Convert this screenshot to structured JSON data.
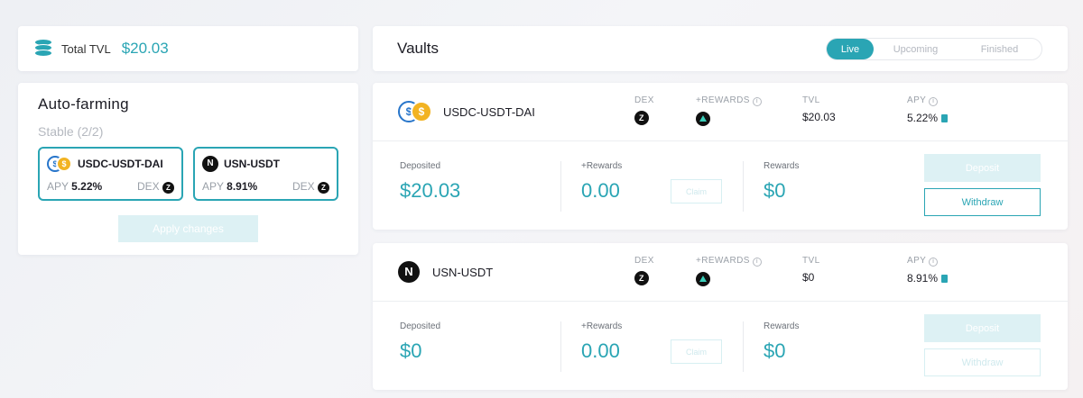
{
  "tvl": {
    "label": "Total TVL",
    "value": "$20.03"
  },
  "autofarming": {
    "title": "Auto-farming",
    "subtitle": "Stable (2/2)",
    "pools": [
      {
        "name": "USDC-USDT-DAI",
        "apy_label": "APY",
        "apy": "5.22%",
        "dex_label": "DEX"
      },
      {
        "name": "USN-USDT",
        "apy_label": "APY",
        "apy": "8.91%",
        "dex_label": "DEX"
      }
    ],
    "apply_label": "Apply changes"
  },
  "vaults": {
    "title": "Vaults",
    "tabs": [
      "Live",
      "Upcoming",
      "Finished"
    ],
    "headers": {
      "dex": "DEX",
      "rewards": "+REWARDS",
      "tvl": "TVL",
      "apy": "APY"
    },
    "labels": {
      "deposited": "Deposited",
      "plus_rewards": "+Rewards",
      "rewards": "Rewards",
      "claim": "Claim",
      "deposit": "Deposit",
      "withdraw": "Withdraw"
    },
    "items": [
      {
        "name": "USDC-USDT-DAI",
        "tvl": "$20.03",
        "apy": "5.22%",
        "deposited": "$20.03",
        "plus_rewards": "0.00",
        "rewards": "$0"
      },
      {
        "name": "USN-USDT",
        "tvl": "$0",
        "apy": "8.91%",
        "deposited": "$0",
        "plus_rewards": "0.00",
        "rewards": "$0"
      }
    ]
  },
  "colors": {
    "accent": "#2aa5b4",
    "usdc": "#2775ca",
    "usdt": "#f2b322"
  },
  "icons": [
    "coins-stack-icon",
    "usdc-coin-icon",
    "usdt-coin-icon",
    "usn-coin-icon",
    "dex-logo-icon",
    "rewards-logo-icon",
    "info-icon",
    "calculator-icon"
  ]
}
